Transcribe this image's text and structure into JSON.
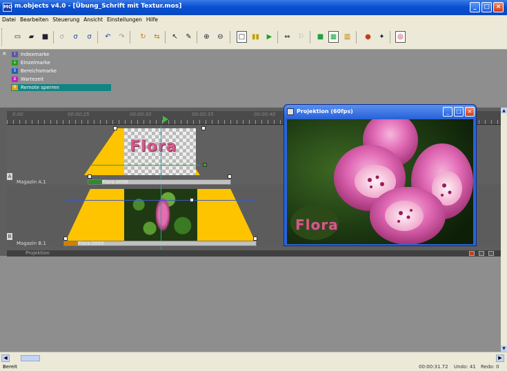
{
  "window": {
    "title": "m.objects v4.0 - [Übung_Schrift mit Textur.mos]",
    "app_icon": "MO",
    "controls": [
      "_",
      "□",
      "×"
    ]
  },
  "menu": [
    "Datei",
    "Bearbeiten",
    "Steuerung",
    "Ansicht",
    "Einstellungen",
    "Hilfe"
  ],
  "toolbar": {
    "icons": [
      "new-icon",
      "open-icon",
      "save-icon",
      "object-icon",
      "object-add-icon",
      "object-edit-icon",
      "undo-icon",
      "redo-icon",
      "refresh-icon",
      "replace-icon",
      "pointer-icon",
      "pen-icon",
      "zoom-in-icon",
      "zoom-out-icon",
      "frame-icon",
      "pause-icon",
      "play-icon",
      "loop-icon",
      "marker-icon",
      "green-icon",
      "grid-icon",
      "bars-icon",
      "palette-icon",
      "wrench-icon",
      "remote-icon"
    ]
  },
  "markers": {
    "items": [
      {
        "label": "Indexmarke",
        "icon": "index-marker-icon",
        "color": "#5a5aa0"
      },
      {
        "label": "Einzelmarke",
        "icon": "single-marker-icon",
        "color": "#20a020"
      },
      {
        "label": "Bereichsmarke",
        "icon": "range-marker-icon",
        "color": "#2060c0"
      },
      {
        "label": "Wartezeit",
        "icon": "wait-marker-icon",
        "color": "#c020c0"
      },
      {
        "label": "Remote sperren",
        "icon": "remote-lock-icon",
        "color": "#e0a000",
        "selected": true
      }
    ]
  },
  "timeline": {
    "ruler_labels": [
      "0:00",
      "00:00:25",
      "00:00:30",
      "00:00:35",
      "00:00:40"
    ],
    "tracks": [
      {
        "letter": "A",
        "name": "Magazin A.1",
        "clip": "Flora 0008"
      },
      {
        "letter": "B",
        "name": "Magazin B.1",
        "clip": "Flora 0009"
      }
    ],
    "preview_text": "Flora",
    "projection_label": "Projektion"
  },
  "projection_window": {
    "title": "Projektion (60fps)",
    "image_text": "Flora"
  },
  "status": {
    "left": "Bereit",
    "time": "00:00:31.72",
    "undo": "Undo: 41",
    "redo": "Redo: 0"
  }
}
